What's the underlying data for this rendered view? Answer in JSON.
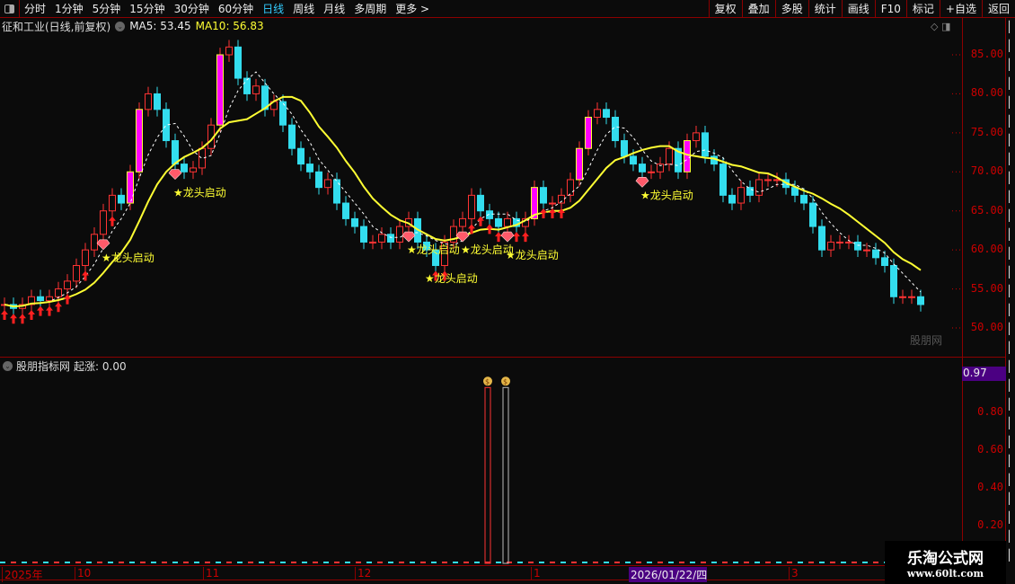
{
  "toolbar": {
    "periods": [
      "分时",
      "1分钟",
      "5分钟",
      "15分钟",
      "30分钟",
      "60分钟",
      "日线",
      "周线",
      "月线",
      "多周期",
      "更多 >"
    ],
    "active": "日线",
    "right_buttons": [
      "复权",
      "叠加",
      "多股",
      "统计",
      "画线",
      "F10",
      "标记",
      "+自选",
      "返回"
    ]
  },
  "header": {
    "stock": "征和工业(日线,前复权)",
    "ma5": "MA5: 53.45",
    "ma10": "MA10: 56.83"
  },
  "sub_header": {
    "name": "股朋指标网",
    "indicator": "起涨: 0.00",
    "current_value": "0.97"
  },
  "price_axis": [
    "85.00",
    "80.00",
    "75.00",
    "70.00",
    "65.00",
    "60.00",
    "55.00",
    "50.00"
  ],
  "sub_axis": [
    "0.80",
    "0.60",
    "0.40",
    "0.20"
  ],
  "date_axis": [
    "2025年",
    "10",
    "11",
    "12",
    "1",
    "2026/01/22/四",
    "3"
  ],
  "watermark": "股朋网",
  "logo": {
    "name": "乐淘公式网",
    "url": "www.60lt.com"
  },
  "colors": {
    "up": "#ff3333",
    "down": "#33ddee",
    "up_fill": "#ff00ff",
    "ma_slow": "#ffff33",
    "ma_fast": "#ffffff",
    "axis": "#cc0000"
  },
  "chart_data": {
    "type": "candlestick",
    "ylim": [
      48,
      88
    ],
    "closes": [
      53,
      52.5,
      53,
      54,
      53.5,
      54,
      55,
      56,
      58,
      60,
      62,
      65,
      67,
      66,
      70,
      78,
      80,
      78,
      74,
      71,
      70,
      70.5,
      73,
      76,
      85,
      86,
      82,
      80,
      81,
      78,
      79,
      76,
      73,
      71,
      70,
      68,
      69,
      66,
      64,
      63,
      61,
      61,
      62,
      61,
      63,
      64,
      61,
      60,
      58,
      61,
      63,
      64,
      67,
      65,
      64,
      63,
      64,
      63,
      64,
      68,
      66,
      66,
      67,
      69,
      73,
      77,
      78,
      77,
      74,
      72,
      71,
      70,
      70,
      71,
      73,
      70,
      74,
      75,
      72,
      71,
      67,
      66,
      68,
      67,
      69,
      69,
      69,
      68,
      67,
      66,
      63,
      60,
      61,
      61,
      61,
      60,
      60,
      59,
      58,
      54,
      54,
      54,
      53
    ],
    "signal_label": "★龙头启动",
    "signals": [
      11,
      19,
      45,
      47,
      51,
      56,
      71
    ],
    "diamonds": [
      11,
      19,
      45,
      51,
      56,
      71
    ],
    "arrows": [
      0,
      1,
      2,
      3,
      4,
      5,
      6,
      7,
      9,
      12,
      48,
      49,
      52,
      53,
      54,
      55,
      57,
      58,
      60,
      61,
      62
    ],
    "sub_bars": [
      {
        "index": 54,
        "value": 0.97
      },
      {
        "index": 56,
        "value": 0.97
      }
    ],
    "sub_ylim": [
      0,
      1
    ]
  }
}
